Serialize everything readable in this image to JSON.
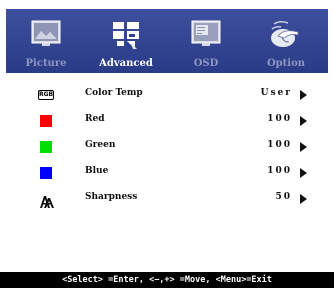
{
  "tabs": [
    {
      "label": "Picture",
      "icon": "picture-icon",
      "active": false
    },
    {
      "label": "Advanced",
      "icon": "advanced-icon",
      "active": true
    },
    {
      "label": "OSD",
      "icon": "osd-icon",
      "active": false
    },
    {
      "label": "Option",
      "icon": "option-hand-icon",
      "active": false
    }
  ],
  "items": [
    {
      "label": "Color Temp",
      "value": "User",
      "icon": "rgb-icon",
      "icon_text": "RGB"
    },
    {
      "label": "Red",
      "value": "100",
      "icon": "red-square-icon",
      "color": "#ff0000"
    },
    {
      "label": "Green",
      "value": "100",
      "icon": "green-square-icon",
      "color": "#00e000"
    },
    {
      "label": "Blue",
      "value": "100",
      "icon": "blue-square-icon",
      "color": "#0000ff"
    },
    {
      "label": "Sharpness",
      "value": "50",
      "icon": "sharpness-icon"
    }
  ],
  "footer": {
    "help": "<Select> =Enter, <−,+> =Move, <Menu>=Exit"
  },
  "colors": {
    "tab_bar": "#2f408c",
    "active_text": "#ffffff",
    "inactive_text": "#8d97c4",
    "footer_bg": "#000000"
  }
}
